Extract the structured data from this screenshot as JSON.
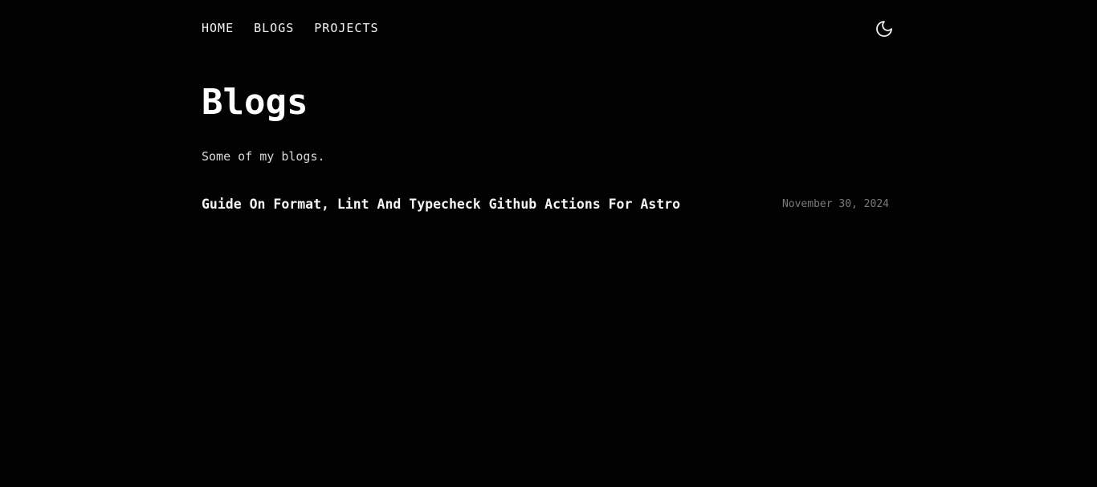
{
  "nav": {
    "links": [
      {
        "label": "HOME"
      },
      {
        "label": "BLOGS"
      },
      {
        "label": "PROJECTS"
      }
    ],
    "theme_toggle_icon": "moon-icon"
  },
  "page": {
    "title": "Blogs",
    "subtitle": "Some of my blogs."
  },
  "posts": [
    {
      "title": "Guide On Format, Lint And Typecheck Github Actions For Astro",
      "date": "November 30, 2024"
    }
  ],
  "colors": {
    "background": "#030203",
    "text": "#f2f2f2",
    "muted": "#7b7b7b"
  }
}
